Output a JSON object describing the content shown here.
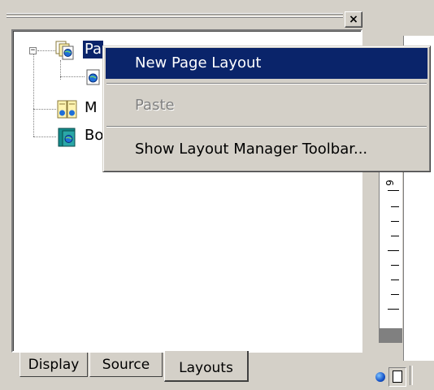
{
  "panel": {
    "close_glyph": "×",
    "tree": {
      "nodes": [
        {
          "label": "Pa",
          "selected": true,
          "icon": "page-layouts-folder-icon"
        },
        {
          "label": "M",
          "icon": "masters-icon"
        },
        {
          "label": "Bo",
          "icon": "book-icon"
        }
      ]
    },
    "tabs": [
      {
        "label": "Display"
      },
      {
        "label": "Source"
      },
      {
        "label": "Layouts",
        "active": true
      }
    ]
  },
  "context_menu": {
    "items": [
      {
        "label": "New Page Layout",
        "highlighted": true,
        "enabled": true
      },
      {
        "label": "Paste",
        "enabled": false
      },
      {
        "label": "Show Layout Manager Toolbar...",
        "enabled": true
      }
    ]
  },
  "ruler": {
    "label": "6"
  },
  "colors": {
    "face": "#d4d0c8",
    "selection": "#0a246a",
    "shadow": "#808080",
    "highlight": "#ffffff"
  }
}
